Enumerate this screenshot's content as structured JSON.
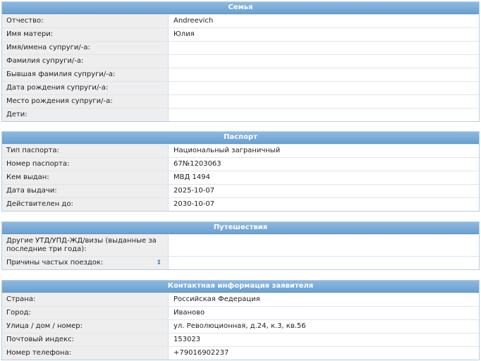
{
  "family": {
    "title": "Семья",
    "rows": [
      {
        "label": "Отчество:",
        "value": "Andreevich"
      },
      {
        "label": "Имя матери:",
        "value": "Юлия"
      },
      {
        "label": "Имя/имена супруги/-а:",
        "value": ""
      },
      {
        "label": "Фамилия супруги/-а:",
        "value": ""
      },
      {
        "label": "Бывшая фамилия супруги/-а:",
        "value": ""
      },
      {
        "label": "Дата рождения супруги/-а:",
        "value": ""
      },
      {
        "label": "Место рождения супруги/-а:",
        "value": ""
      },
      {
        "label": "Дети:",
        "value": ""
      }
    ]
  },
  "passport": {
    "title": "Паспорт",
    "rows": [
      {
        "label": "Тип паспорта:",
        "value": "Национальный заграничный"
      },
      {
        "label": "Номер паспорта:",
        "value": "67№1203063"
      },
      {
        "label": "Кем выдан:",
        "value": "МВД 1494"
      },
      {
        "label": "Дата выдачи:",
        "value": "2025-10-07"
      },
      {
        "label": "Действителен до:",
        "value": "2030-10-07"
      }
    ]
  },
  "travel": {
    "title": "Путешествия",
    "rows": [
      {
        "label": "Другие УТД/УПД-ЖД/визы (выданные за последние три года):",
        "value": ""
      },
      {
        "label": "Причины частых поездок:",
        "value": "",
        "icon": "info-icon",
        "icon_glyph": "↕"
      }
    ]
  },
  "contact": {
    "title": "Контактная информация заявителя",
    "rows": [
      {
        "label": "Страна:",
        "value": "Российская Федерация"
      },
      {
        "label": "Город:",
        "value": "Иваново"
      },
      {
        "label": "Улица / дом / номер:",
        "value": "ул. Революционная, д.24, к.3, кв.56"
      },
      {
        "label": "Почтовый индекс:",
        "value": "153023"
      },
      {
        "label": "Номер телефона:",
        "value": "+79016902237"
      }
    ]
  }
}
